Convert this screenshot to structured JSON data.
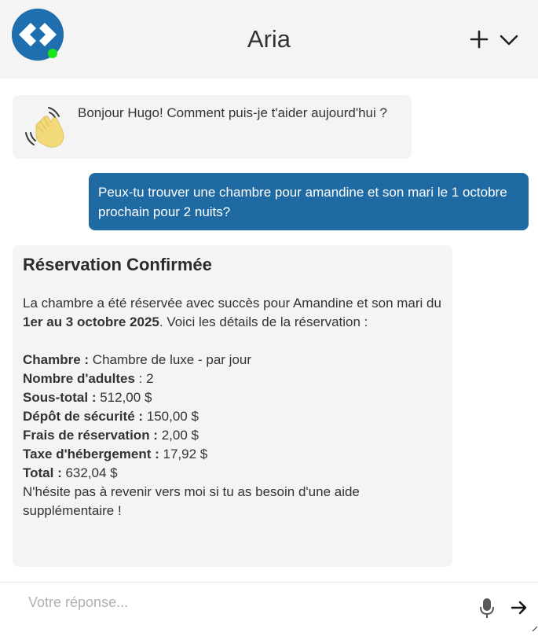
{
  "header": {
    "title": "Aria",
    "online": true,
    "icons": {
      "avatar": "code-brackets-logo-icon",
      "new_chat": "plus-icon",
      "collapse": "chevron-down-icon"
    }
  },
  "conversation": {
    "greeting": {
      "icon": "waving-hand-icon",
      "text": "Bonjour Hugo! Comment puis-je t'aider aujourd'hui ?"
    },
    "user_message": {
      "text": "Peux-tu trouver une chambre pour amandine et son mari le 1 octobre prochain pour 2 nuits?"
    },
    "reservation": {
      "title": "Réservation Confirmée",
      "intro_start": "La chambre a été réservée avec succès pour Amandine et son mari du ",
      "intro_dates": "1er au 3 octobre 2025",
      "intro_end": ". Voici les détails de la réservation :",
      "details": [
        {
          "label": "Chambre :",
          "value": " Chambre de luxe - par jour"
        },
        {
          "label": "Nombre d'adultes",
          "value": " : 2"
        },
        {
          "label": "Sous-total :",
          "value": " 512,00 $"
        },
        {
          "label": "Dépôt de sécurité :",
          "value": " 150,00 $"
        },
        {
          "label": "Frais de réservation :",
          "value": " 2,00 $"
        },
        {
          "label": "Taxe d'hébergement :",
          "value": " 17,92 $"
        },
        {
          "label": "Total :",
          "value": " 632,04 $"
        }
      ],
      "closing": "N'hésite pas à revenir vers moi si tu as besoin d'une aide supplémentaire !"
    }
  },
  "input": {
    "placeholder": "Votre réponse...",
    "value": "",
    "icons": {
      "mic": "microphone-icon",
      "send": "arrow-right-icon"
    }
  },
  "colors": {
    "header_bg": "#f5f4f5",
    "accent": "#1f6aa3",
    "online": "#19e619",
    "bubble_bg": "#f5f4f5"
  }
}
